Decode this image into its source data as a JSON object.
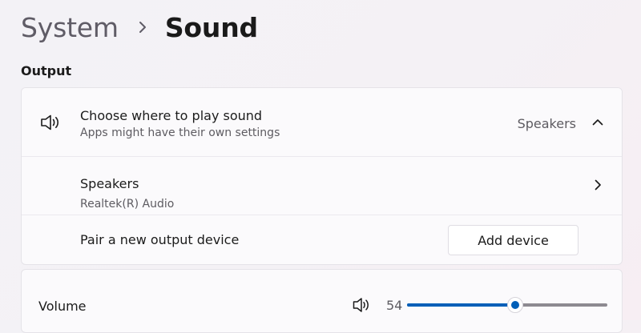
{
  "theme": {
    "accent": "#005fb8",
    "background": "#f4f1f5",
    "card": "#fbfafc"
  },
  "breadcrumb": {
    "parent": "System",
    "separator_icon": "chevron-right-icon",
    "current": "Sound"
  },
  "output": {
    "section_title": "Output",
    "choose_row": {
      "icon": "speaker-icon",
      "title": "Choose where to play sound",
      "subtitle": "Apps might have their own settings",
      "selected_device": "Speakers",
      "expand_icon": "chevron-up-icon"
    },
    "speakers_row": {
      "title": "Speakers",
      "subtitle": "Realtek(R) Audio",
      "navigate_icon": "chevron-right-icon"
    },
    "pair_row": {
      "title": "Pair a new output device",
      "button_label": "Add device"
    }
  },
  "volume": {
    "label": "Volume",
    "icon": "speaker-icon",
    "value": "54",
    "percent": 54
  }
}
